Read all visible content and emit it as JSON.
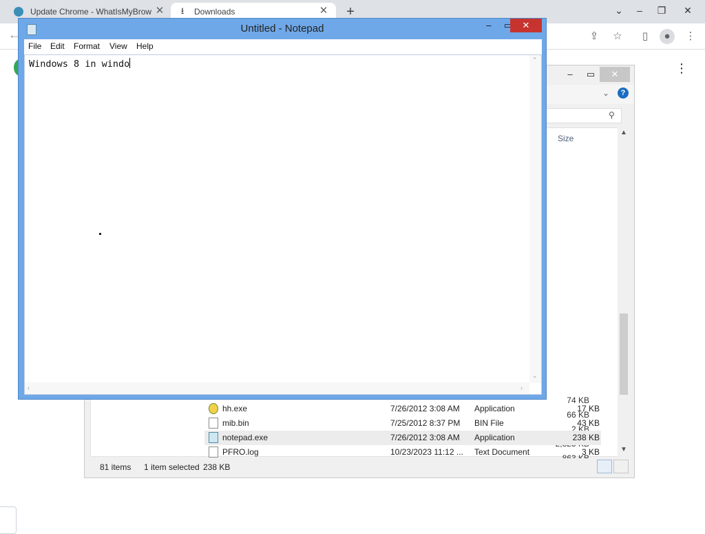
{
  "browser": {
    "tabs": [
      {
        "title": "Update Chrome - WhatIsMyBrow",
        "active": false,
        "icon": "globe-icon"
      },
      {
        "title": "Downloads",
        "active": true,
        "icon": "download-icon"
      }
    ],
    "new_tab": "+",
    "toolbar_icons": [
      "back-icon",
      "share-icon",
      "star-icon",
      "sidebar-icon",
      "profile-icon",
      "menu-icon"
    ]
  },
  "explorer": {
    "column_size": "Size",
    "rows_partial": [
      {
        "size": "74 KB"
      },
      {
        "size": "66 KB"
      },
      {
        "size": "2 KB"
      },
      {
        "size": "2,325 KB"
      },
      {
        "size": "863 KB"
      }
    ],
    "rows": [
      {
        "name": "hh.exe",
        "date": "7/26/2012 3:08 AM",
        "type": "Application",
        "size": "17 KB",
        "icon": "help-file-icon",
        "selected": false
      },
      {
        "name": "mib.bin",
        "date": "7/25/2012 8:37 PM",
        "type": "BIN File",
        "size": "43 KB",
        "icon": "file-icon",
        "selected": false
      },
      {
        "name": "notepad.exe",
        "date": "7/26/2012 3:08 AM",
        "type": "Application",
        "size": "238 KB",
        "icon": "notepad-icon",
        "selected": true
      },
      {
        "name": "PFRO.log",
        "date": "10/23/2023 11:12 ...",
        "type": "Text Document",
        "size": "3 KB",
        "icon": "file-icon",
        "selected": false
      }
    ],
    "status": {
      "items": "81 items",
      "selected": "1 item selected",
      "selected_size": "238 KB"
    }
  },
  "notepad": {
    "title": "Untitled - Notepad",
    "menu": [
      "File",
      "Edit",
      "Format",
      "View",
      "Help"
    ],
    "text": "Windows 8 in windo"
  }
}
